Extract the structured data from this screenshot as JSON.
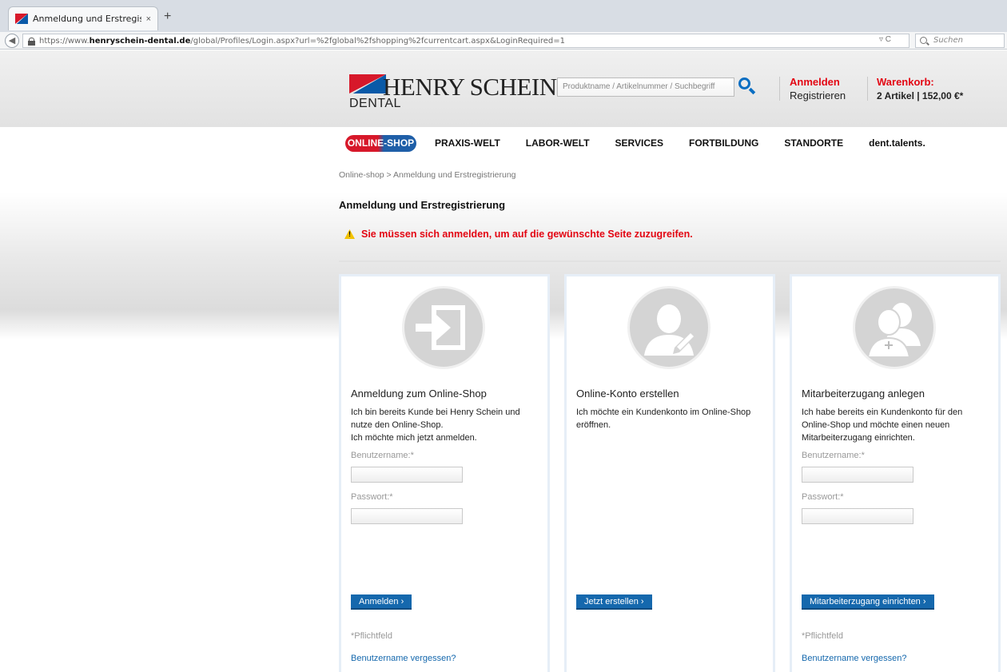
{
  "browser": {
    "tab_title": "Anmeldung und Erstregistr...",
    "tab_close": "×",
    "new_tab": "+",
    "url_prefix": "https://www.",
    "url_domain": "henryschein-dental.de",
    "url_path": "/global/Profiles/Login.aspx?url=%2fglobal%2fshopping%2fcurrentcart.aspx&LoginRequired=1",
    "url_controls": "▿ C",
    "search_placeholder": "Suchen"
  },
  "header": {
    "logo_name": "HENRY SCHEIN®",
    "logo_sub": "DENTAL",
    "search_placeholder": "Produktname / Artikelnummer / Suchbegriff",
    "login_label": "Anmelden",
    "register_label": "Registrieren",
    "cart_title": "Warenkorb:",
    "cart_info": "2  Artikel | 152,00 €*"
  },
  "nav": {
    "online_shop": "ONLINE-SHOP",
    "items": [
      "PRAXIS-WELT",
      "LABOR-WELT",
      "SERVICES",
      "FORTBILDUNG",
      "STANDORTE",
      "dent.talents."
    ]
  },
  "breadcrumb": "Online-shop > Anmeldung und Erstregistrierung",
  "page_title": "Anmeldung und Erstregistrierung",
  "alert": "Sie müssen sich anmelden, um auf die gewünschte Seite zuzugreifen.",
  "panels": [
    {
      "heading": "Anmeldung zum Online-Shop",
      "desc": "Ich bin bereits Kunde bei Henry Schein und nutze den Online-Shop.\nIch möchte mich jetzt anmelden.",
      "username_label": "Benutzername:*",
      "password_label": "Passwort:*",
      "button": "Anmelden ›",
      "required_note": "*Pflichtfeld",
      "forgot": "Benutzername vergessen?"
    },
    {
      "heading": "Online-Konto erstellen",
      "desc": "Ich möchte ein Kundenkonto im Online-Shop eröffnen.",
      "button": "Jetzt erstellen ›"
    },
    {
      "heading": "Mitarbeiterzugang anlegen",
      "desc": "Ich habe bereits ein Kundenkonto für den Online-Shop und möchte einen neuen Mitarbeiterzugang einrichten.",
      "username_label": "Benutzername:*",
      "password_label": "Passwort:*",
      "button": "Mitarbeiterzugang einrichten ›",
      "required_note": "*Pflichtfeld",
      "forgot": "Benutzername vergessen?"
    }
  ]
}
